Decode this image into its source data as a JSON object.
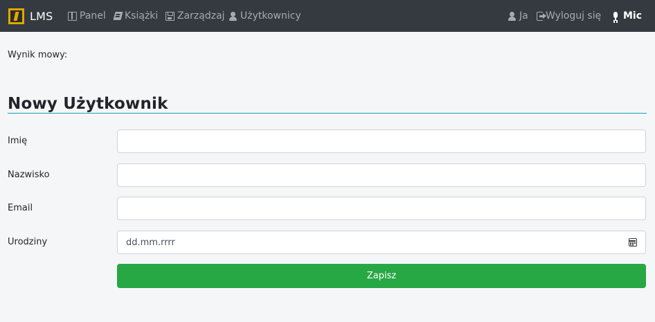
{
  "brand": {
    "name": "LMS"
  },
  "nav": {
    "left": [
      {
        "label": "Panel",
        "icon": "panel-icon"
      },
      {
        "label": "Książki",
        "icon": "book-icon"
      },
      {
        "label": "Zarządzaj",
        "icon": "save-icon"
      },
      {
        "label": "Użytkownicy",
        "icon": "user-icon"
      }
    ],
    "right": [
      {
        "label": "Ja",
        "icon": "user-icon"
      },
      {
        "label": "Wyloguj się",
        "icon": "logout-icon"
      },
      {
        "label": "Mic",
        "icon": "microphone-icon"
      }
    ]
  },
  "speech_result": {
    "label": "Wynik mowy:"
  },
  "form": {
    "title": "Nowy Użytkownik",
    "fields": [
      {
        "label": "Imię",
        "value": "",
        "placeholder": ""
      },
      {
        "label": "Nazwisko",
        "value": "",
        "placeholder": ""
      },
      {
        "label": "Email",
        "value": "",
        "placeholder": ""
      },
      {
        "label": "Urodziny",
        "value": "dd.mm.rrrr",
        "placeholder": ""
      }
    ],
    "submit_label": "Zapisz"
  },
  "colors": {
    "navbar_bg": "#343a40",
    "page_bg": "#f5f6f8",
    "accent_rule": "#17a2b8",
    "submit_bg": "#28a745",
    "brand_logo": "#e0a800"
  }
}
